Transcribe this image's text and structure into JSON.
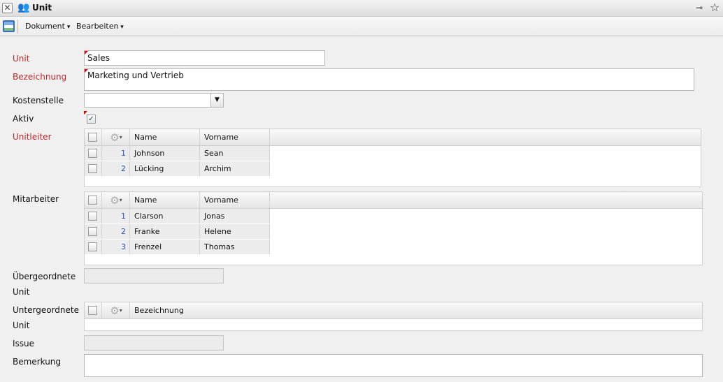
{
  "window": {
    "title": "Unit"
  },
  "toolbar": {
    "menus": [
      "Dokument",
      "Bearbeiten"
    ]
  },
  "form": {
    "unit": {
      "label": "Unit",
      "value": "Sales"
    },
    "bezeichnung": {
      "label": "Bezeichnung",
      "value": "Marketing und Vertrieb"
    },
    "kostenstelle": {
      "label": "Kostenstelle",
      "value": ""
    },
    "aktiv": {
      "label": "Aktiv",
      "checked": true
    },
    "unitleiter": {
      "label": "Unitleiter",
      "columns": [
        "Name",
        "Vorname"
      ],
      "rows": [
        {
          "n": "1",
          "name": "Johnson",
          "vorname": "Sean"
        },
        {
          "n": "2",
          "name": "Lücking",
          "vorname": "Archim"
        }
      ]
    },
    "mitarbeiter": {
      "label": "Mitarbeiter",
      "columns": [
        "Name",
        "Vorname"
      ],
      "rows": [
        {
          "n": "1",
          "name": "Clarson",
          "vorname": "Jonas"
        },
        {
          "n": "2",
          "name": "Franke",
          "vorname": "Helene"
        },
        {
          "n": "3",
          "name": "Frenzel",
          "vorname": "Thomas"
        }
      ]
    },
    "uebergeordnete": {
      "label1": "Übergeordnete",
      "label2": "Unit"
    },
    "untergeordnete": {
      "label1": "Untergeordnete",
      "label2": "Unit",
      "columns": [
        "Bezeichnung"
      ]
    },
    "issue": {
      "label": "Issue"
    },
    "bemerkung": {
      "label": "Bemerkung"
    }
  }
}
